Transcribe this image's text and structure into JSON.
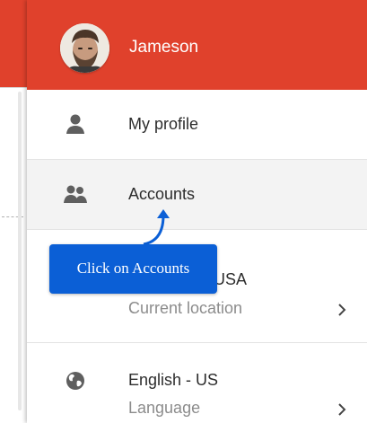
{
  "header": {
    "user_name": "Jameson",
    "avatar_icon": "user-avatar-photo",
    "background_color": "#e0412c"
  },
  "menu": {
    "items": [
      {
        "label": "My profile",
        "icon": "person-icon"
      },
      {
        "label": "Accounts",
        "icon": "people-icon",
        "selected": true
      },
      {
        "label": "USA",
        "sublabel": "Current location",
        "icon": "chevron-right-icon"
      },
      {
        "label": "English - US",
        "sublabel": "Language",
        "icon": "globe-icon"
      }
    ]
  },
  "tooltip": {
    "text": "Click on Accounts",
    "color": "#0b5fd6"
  }
}
